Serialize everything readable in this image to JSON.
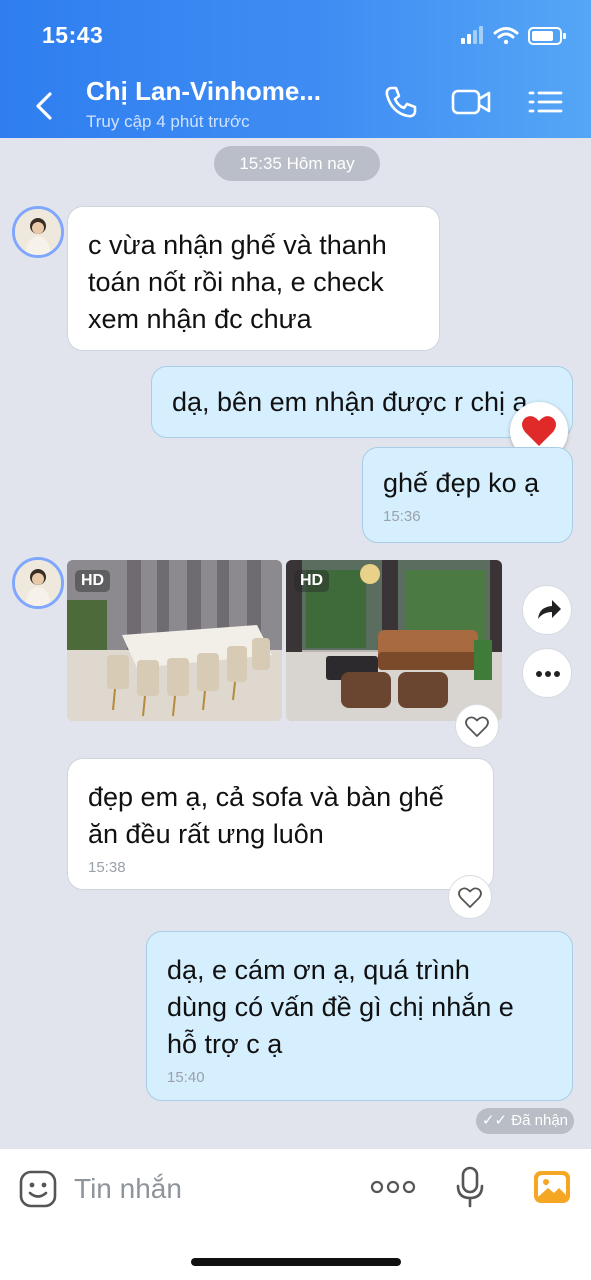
{
  "status_bar": {
    "time": "15:43"
  },
  "header": {
    "contact_name": "Chị Lan-Vinhome...",
    "contact_status": "Truy cập 4 phút trước"
  },
  "chat": {
    "date_separator": "15:35 Hôm nay",
    "messages": [
      {
        "direction": "in",
        "text_lines": [
          "c vừa nhận ghế và thanh",
          "toán nốt rồi nha, e check",
          "xem nhận đc chưa"
        ]
      },
      {
        "direction": "out",
        "text": "dạ, bên em nhận được r chị ạ",
        "reaction": "heart"
      },
      {
        "direction": "out",
        "text": "ghế đẹp ko ạ",
        "time": "15:36"
      },
      {
        "direction": "in",
        "type": "photos",
        "photos": [
          {
            "badge": "HD"
          },
          {
            "badge": "HD"
          }
        ]
      },
      {
        "direction": "in",
        "text_lines": [
          "đẹp em ạ, cả sofa và bàn ghế",
          "ăn đều rất ưng luôn"
        ],
        "time": "15:38"
      },
      {
        "direction": "out",
        "text_lines": [
          "dạ, e cám ơn ạ, quá trình",
          "dùng có vấn đề gì chị nhắn e",
          "hỗ trợ c ạ"
        ],
        "time": "15:40"
      }
    ],
    "seen_label": "Đã nhận"
  },
  "input_bar": {
    "placeholder": "Tin nhắn"
  },
  "colors": {
    "header_gradient_start": "#2f7ef0",
    "header_gradient_end": "#55a6f6",
    "chat_background": "#e1e4ec",
    "outgoing_bubble": "#d5efff",
    "incoming_bubble": "#ffffff",
    "heart": "#e02a2a",
    "gallery_icon": "#f5a623"
  },
  "icons": [
    "back-icon",
    "phone-icon",
    "video-call-icon",
    "menu-list-icon",
    "heart-reaction-icon",
    "heart-outline-icon",
    "forward-arrow-icon",
    "more-dots-icon",
    "sticker-smile-icon",
    "more-options-icon",
    "microphone-icon",
    "gallery-icon"
  ]
}
